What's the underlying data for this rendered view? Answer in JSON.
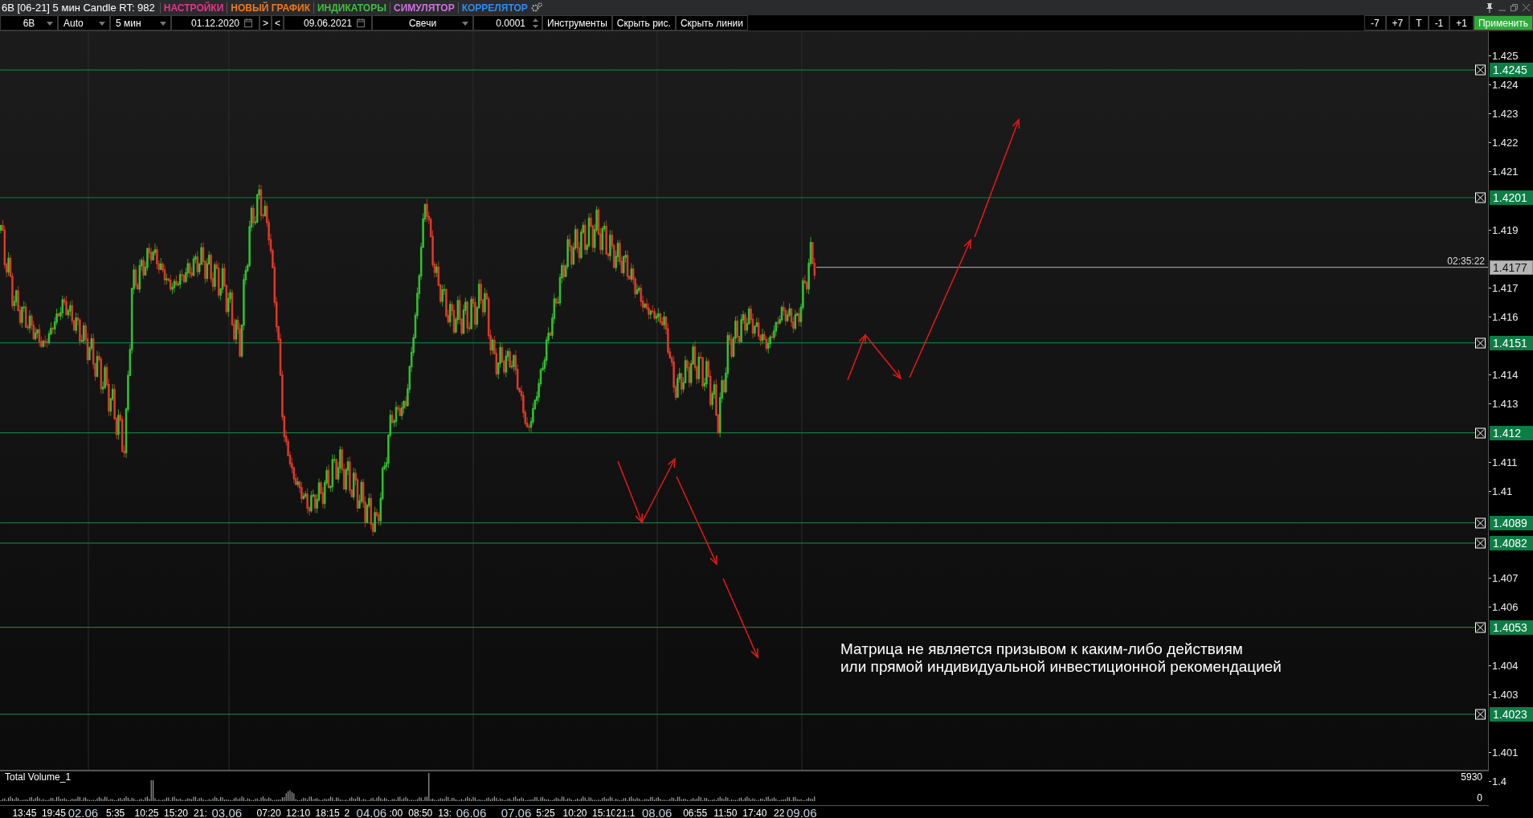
{
  "title_bar": {
    "title": "6B [06-21] 5 мин Candle RT: 982",
    "menu": [
      {
        "label": "НАСТРОЙКИ",
        "color": "#e8348c"
      },
      {
        "label": "НОВЫЙ ГРАФИК",
        "color": "#f07a1a"
      },
      {
        "label": "ИНДИКАТОРЫ",
        "color": "#3cc23c"
      },
      {
        "label": "СИМУЛЯТОР",
        "color": "#d070e0"
      },
      {
        "label": "КОРРЕЛЯТОР",
        "color": "#2e8ef0"
      }
    ]
  },
  "toolbar": {
    "items": [
      {
        "kind": "dropdown",
        "value": "6B"
      },
      {
        "kind": "dropdown",
        "value": "Auto"
      },
      {
        "kind": "dropdown",
        "value": "5 мин"
      },
      {
        "kind": "date",
        "value": "01.12.2020"
      },
      {
        "kind": "button",
        "value": ">"
      },
      {
        "kind": "button",
        "value": "<"
      },
      {
        "kind": "date",
        "value": "09.06.2021"
      },
      {
        "kind": "dropdown",
        "value": "Свечи"
      },
      {
        "kind": "spinner",
        "value": "0.0001"
      },
      {
        "kind": "button",
        "value": "Инструменты"
      },
      {
        "kind": "button",
        "value": "Скрыть рис."
      },
      {
        "kind": "button",
        "value": "Скрыть линии"
      }
    ],
    "right_buttons": [
      {
        "label": "-7",
        "kind": "plain"
      },
      {
        "label": "+7",
        "kind": "plain"
      },
      {
        "label": "T",
        "kind": "plain"
      },
      {
        "label": "-1",
        "kind": "plain"
      },
      {
        "label": "+1",
        "kind": "plain"
      },
      {
        "label": "Применить",
        "kind": "apply"
      }
    ]
  },
  "price_axis": {
    "ticks": [
      "1.425",
      "1.424",
      "1.423",
      "1.422",
      "1.421",
      "1.419",
      "1.417",
      "1.416",
      "1.414",
      "1.413",
      "1.411",
      "1.41",
      "1.407",
      "1.406",
      "1.404",
      "1.403",
      "1.401",
      "1.4"
    ]
  },
  "levels": [
    {
      "price": "1.4245"
    },
    {
      "price": "1.4201"
    },
    {
      "price": "1.4151"
    },
    {
      "price": "1.412"
    },
    {
      "price": "1.4089"
    },
    {
      "price": "1.4082"
    },
    {
      "price": "1.4053"
    },
    {
      "price": "1.4023"
    }
  ],
  "current_price": {
    "price": "1.4177",
    "timer": "02:35:22"
  },
  "note": [
    "Матрица не является призывом к каким-либо действиям",
    "или прямой индивидуальной инвестиционной рекомендацией"
  ],
  "volume_pane": {
    "title": "Total Volume_1",
    "max": "5930",
    "min": "0"
  },
  "time_axis": [
    {
      "kind": "time",
      "label": "13:45"
    },
    {
      "kind": "time",
      "label": "19:45"
    },
    {
      "kind": "date",
      "label": "02.06"
    },
    {
      "kind": "time",
      "label": "5:35"
    },
    {
      "kind": "time",
      "label": "10:25"
    },
    {
      "kind": "time",
      "label": "15:20"
    },
    {
      "kind": "time",
      "label": "21:"
    },
    {
      "kind": "date",
      "label": "03.06"
    },
    {
      "kind": "time",
      "label": "07:20"
    },
    {
      "kind": "time",
      "label": "12:10"
    },
    {
      "kind": "time",
      "label": "18:15"
    },
    {
      "kind": "time",
      "label": "2"
    },
    {
      "kind": "date",
      "label": "04.06"
    },
    {
      "kind": "time",
      "label": ":00"
    },
    {
      "kind": "time",
      "label": "08:50"
    },
    {
      "kind": "time",
      "label": "13:"
    },
    {
      "kind": "date",
      "label": "06.06"
    },
    {
      "kind": "date",
      "label": "07.06"
    },
    {
      "kind": "time",
      "label": "5:25"
    },
    {
      "kind": "time",
      "label": "10:20"
    },
    {
      "kind": "time",
      "label": "15:10"
    },
    {
      "kind": "time",
      "label": "21:1"
    },
    {
      "kind": "date",
      "label": "08.06"
    },
    {
      "kind": "time",
      "label": "06:55"
    },
    {
      "kind": "time",
      "label": "11:50"
    },
    {
      "kind": "time",
      "label": "17:40"
    },
    {
      "kind": "time",
      "label": "22"
    },
    {
      "kind": "date",
      "label": "09.06"
    }
  ]
}
